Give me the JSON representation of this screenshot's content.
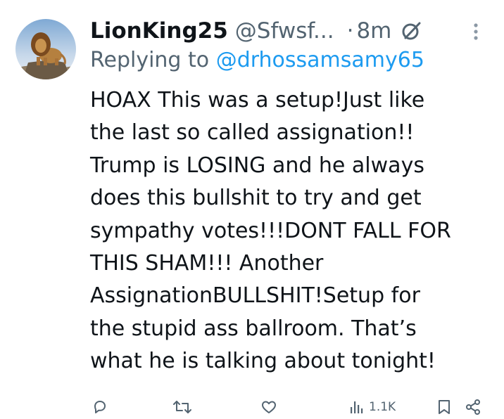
{
  "tweet": {
    "display_name": "LionKing25",
    "handle": "@Sfwsf...",
    "separator": "·",
    "time": "8m",
    "reply_prefix": "Replying to",
    "reply_mention": "@drhossamsamy65",
    "body_lines": [
      "HOAX This was a setup!Just like",
      "the last so called assignation!!",
      "Trump is LOSING and he always",
      "does this bullshit to try and get",
      "sympathy votes!!!DONT FALL FOR",
      "THIS SHAM!!!  Another",
      "AssignationBULLSHIT!Setup for",
      "the stupid ass ballroom. That’s",
      "what he is talking about tonight!"
    ],
    "views_count": "1.1K"
  },
  "icons": {
    "avatar": "lion-avatar",
    "grok": "grok-icon",
    "more": "more-icon",
    "reply": "reply-icon",
    "retweet": "retweet-icon",
    "like": "like-icon",
    "views": "views-icon",
    "bookmark": "bookmark-icon",
    "share": "share-icon"
  },
  "colors": {
    "text": "#0f1419",
    "secondary": "#536471",
    "mention": "#1d9bf0"
  }
}
